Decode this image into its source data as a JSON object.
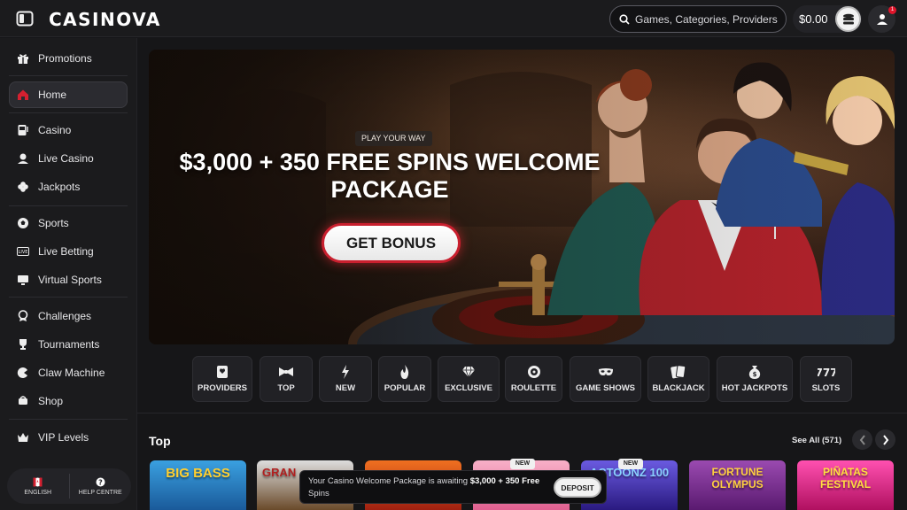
{
  "header": {
    "logo": "CASINOVA",
    "search_placeholder": "Games, Categories, Providers",
    "balance": "$0.00",
    "notification_count": "1"
  },
  "sidebar": {
    "items": [
      {
        "label": "Promotions",
        "icon": "gift-icon"
      },
      {
        "label": "Home",
        "icon": "home-icon",
        "active": true
      },
      {
        "label": "Casino",
        "icon": "slot-machine-icon"
      },
      {
        "label": "Live Casino",
        "icon": "dealer-icon"
      },
      {
        "label": "Jackpots",
        "icon": "clover-icon"
      },
      {
        "label": "Sports",
        "icon": "soccer-ball-icon"
      },
      {
        "label": "Live Betting",
        "icon": "live-icon"
      },
      {
        "label": "Virtual Sports",
        "icon": "monitor-icon"
      },
      {
        "label": "Challenges",
        "icon": "badge-icon"
      },
      {
        "label": "Tournaments",
        "icon": "trophy-icon"
      },
      {
        "label": "Claw Machine",
        "icon": "claw-icon"
      },
      {
        "label": "Shop",
        "icon": "cart-icon"
      },
      {
        "label": "VIP Levels",
        "icon": "crown-icon"
      }
    ],
    "bottom": {
      "language": "ENGLISH",
      "help": "HELP CENTRE"
    }
  },
  "hero": {
    "badge": "PLAY YOUR WAY",
    "title_line1": "$3,000 + 350 FREE SPINS WELCOME",
    "title_line2": "PACKAGE",
    "cta": "GET BONUS"
  },
  "categories": [
    {
      "label": "PROVIDERS",
      "icon": "card-icon"
    },
    {
      "label": "TOP",
      "icon": "bowtie-icon"
    },
    {
      "label": "NEW",
      "icon": "lightning-icon"
    },
    {
      "label": "POPULAR",
      "icon": "flame-icon"
    },
    {
      "label": "EXCLUSIVE",
      "icon": "diamond-icon"
    },
    {
      "label": "ROULETTE",
      "icon": "roulette-icon"
    },
    {
      "label": "GAME SHOWS",
      "icon": "mask-icon"
    },
    {
      "label": "BLACKJACK",
      "icon": "cards-icon"
    },
    {
      "label": "HOT JACKPOTS",
      "icon": "money-bag-icon"
    },
    {
      "label": "SLOTS",
      "icon": "777-icon"
    }
  ],
  "section": {
    "title": "Top",
    "see_all": "See All (571)"
  },
  "tiles": [
    {
      "title": "BIG BASS",
      "new": false,
      "color": "#2a7fc4"
    },
    {
      "title": "GRAN",
      "new": false,
      "color": "#3a2a1a"
    },
    {
      "title": "",
      "new": false,
      "color": "#c0351c"
    },
    {
      "title": "",
      "new": true,
      "color": "#e67aa0"
    },
    {
      "title": "ACTOONZ 100",
      "new": true,
      "color": "#4a3bb8"
    },
    {
      "title": "FORTUNE OLYMPUS",
      "new": false,
      "color": "#7a2f8f"
    },
    {
      "title": "PIÑATAS FESTIVAL",
      "new": false,
      "color": "#e0208a"
    }
  ],
  "new_badge": "NEW",
  "toast": {
    "text_prefix": "Your Casino Welcome Package is awaiting ",
    "text_bold": "$3,000 + 350 Free",
    "text_line2": "Spins",
    "button": "DEPOSIT"
  },
  "colors": {
    "accent": "#c91f2e",
    "bg": "#161618",
    "panel": "#1b1b1d"
  }
}
